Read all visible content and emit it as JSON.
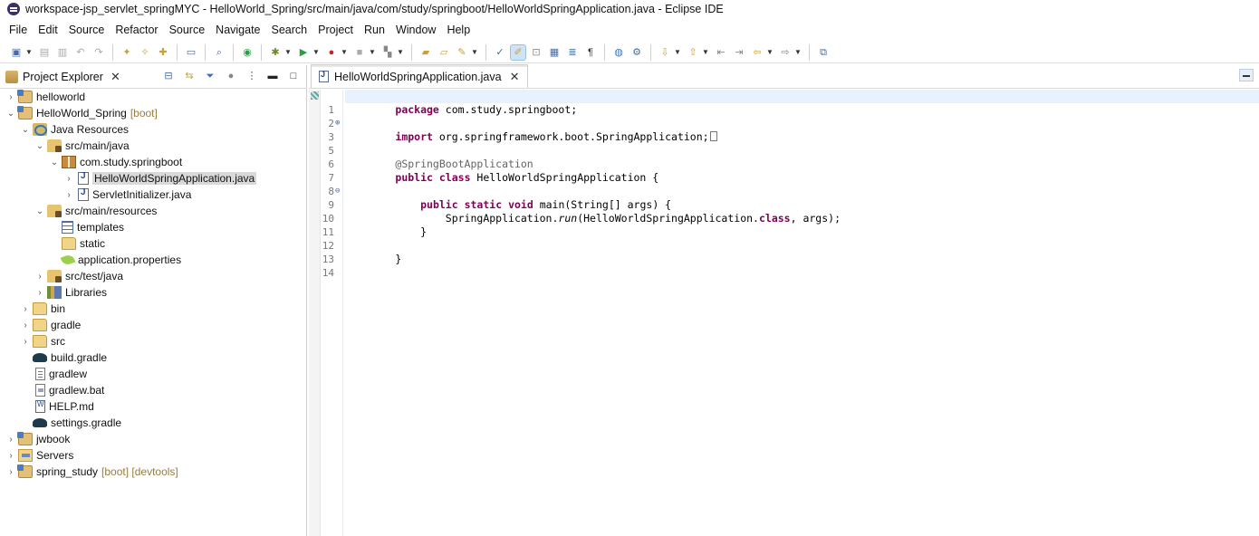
{
  "window": {
    "title": "workspace-jsp_servlet_springMYC - HelloWorld_Spring/src/main/java/com/study/springboot/HelloWorldSpringApplication.java - Eclipse IDE"
  },
  "menu": [
    "File",
    "Edit",
    "Source",
    "Refactor",
    "Source",
    "Navigate",
    "Search",
    "Project",
    "Run",
    "Window",
    "Help"
  ],
  "explorer": {
    "title": "Project Explorer",
    "tree": [
      {
        "label": "helloworld",
        "deco": "",
        "icon": "project-icon"
      },
      {
        "label": "HelloWorld_Spring",
        "deco": "[boot]",
        "icon": "project-icon"
      },
      {
        "label": "Java Resources",
        "deco": "",
        "icon": "java-resources-icon"
      },
      {
        "label": "src/main/java",
        "deco": "",
        "icon": "source-folder-icon"
      },
      {
        "label": "com.study.springboot",
        "deco": "",
        "icon": "package-icon"
      },
      {
        "label": "HelloWorldSpringApplication.java",
        "deco": "",
        "icon": "java-file-icon"
      },
      {
        "label": "ServletInitializer.java",
        "deco": "",
        "icon": "java-file-icon"
      },
      {
        "label": "src/main/resources",
        "deco": "",
        "icon": "source-folder-icon"
      },
      {
        "label": "templates",
        "deco": "",
        "icon": "templates-folder-icon"
      },
      {
        "label": "static",
        "deco": "",
        "icon": "folder-icon"
      },
      {
        "label": "application.properties",
        "deco": "",
        "icon": "properties-file-icon"
      },
      {
        "label": "src/test/java",
        "deco": "",
        "icon": "source-folder-icon"
      },
      {
        "label": "Libraries",
        "deco": "",
        "icon": "libraries-icon"
      },
      {
        "label": "bin",
        "deco": "",
        "icon": "folder-icon"
      },
      {
        "label": "gradle",
        "deco": "",
        "icon": "folder-icon"
      },
      {
        "label": "src",
        "deco": "",
        "icon": "folder-icon"
      },
      {
        "label": "build.gradle",
        "deco": "",
        "icon": "gradle-icon"
      },
      {
        "label": "gradlew",
        "deco": "",
        "icon": "text-file-icon"
      },
      {
        "label": "gradlew.bat",
        "deco": "",
        "icon": "bat-file-icon"
      },
      {
        "label": "HELP.md",
        "deco": "",
        "icon": "markdown-file-icon"
      },
      {
        "label": "settings.gradle",
        "deco": "",
        "icon": "gradle-icon"
      },
      {
        "label": "jwbook",
        "deco": "",
        "icon": "project-icon"
      },
      {
        "label": "Servers",
        "deco": "",
        "icon": "servers-icon"
      },
      {
        "label": "spring_study",
        "deco": "[boot] [devtools]",
        "icon": "project-icon"
      }
    ]
  },
  "editor": {
    "tab_label": "HelloWorldSpringApplication.java",
    "line_numbers": [
      "1",
      "2",
      "3",
      "5",
      "6",
      "7",
      "8",
      "9",
      "10",
      "11",
      "12",
      "13",
      "14"
    ],
    "lines": [
      {
        "k1": "package",
        "t1": " com.study.springboot;"
      },
      {},
      {
        "k1": "import",
        "t1": " org.springframework.boot.SpringApplication;"
      },
      {},
      {
        "ann": "@SpringBootApplication"
      },
      {
        "k1": "public",
        "k2": "class",
        "t1": " HelloWorldSpringApplication {"
      },
      {},
      {
        "k1": "public",
        "k2": "static",
        "k3": "void",
        "t1": " main(String[] args) {"
      },
      {
        "t0": "SpringApplication.",
        "it": "run",
        "t1": "(HelloWorldSpringApplication.",
        "k1": "class",
        "t2": ", args);"
      },
      {
        "t1": "}"
      },
      {},
      {
        "t1": "}"
      },
      {}
    ]
  },
  "colors": {
    "keyword": "#7f0055",
    "annotation": "#646464",
    "current_line": "#e8f2fe",
    "boot_decoration": "#9a7d3d"
  }
}
